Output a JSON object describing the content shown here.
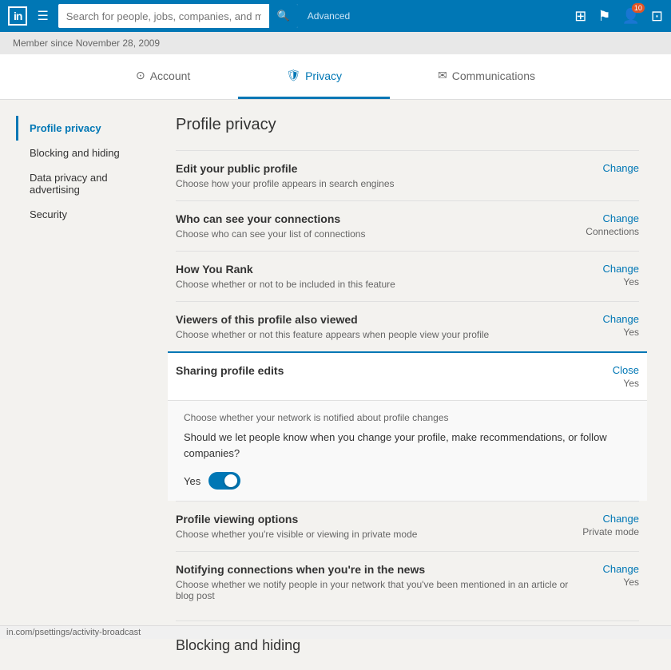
{
  "topnav": {
    "logo_text": "in",
    "search_placeholder": "Search for people, jobs, companies, and more...",
    "advanced_label": "Advanced",
    "notification_count": "10"
  },
  "subheader": {
    "member_since": "Member since November 28, 2009"
  },
  "tabs": [
    {
      "id": "account",
      "label": "Account",
      "icon": "⊙",
      "active": false
    },
    {
      "id": "privacy",
      "label": "Privacy",
      "icon": "🛡",
      "active": true
    },
    {
      "id": "communications",
      "label": "Communications",
      "icon": "✉",
      "active": false
    }
  ],
  "sidebar": {
    "items": [
      {
        "id": "profile-privacy",
        "label": "Profile privacy",
        "active": true
      },
      {
        "id": "blocking-hiding",
        "label": "Blocking and hiding",
        "active": false
      },
      {
        "id": "data-privacy",
        "label": "Data privacy and advertising",
        "active": false
      },
      {
        "id": "security",
        "label": "Security",
        "active": false
      }
    ]
  },
  "content": {
    "page_title": "Profile privacy",
    "settings": [
      {
        "id": "public-profile",
        "title": "Edit your public profile",
        "desc": "Choose how your profile appears in search engines",
        "action": "Change",
        "value": "",
        "expanded": false
      },
      {
        "id": "who-can-see",
        "title": "Who can see your connections",
        "desc": "Choose who can see your list of connections",
        "action": "Change",
        "value": "Connections",
        "expanded": false
      },
      {
        "id": "how-you-rank",
        "title": "How You Rank",
        "desc": "Choose whether or not to be included in this feature",
        "action": "Change",
        "value": "Yes",
        "expanded": false
      },
      {
        "id": "viewers-also-viewed",
        "title": "Viewers of this profile also viewed",
        "desc": "Choose whether or not this feature appears when people view your profile",
        "action": "Change",
        "value": "Yes",
        "expanded": false
      },
      {
        "id": "sharing-profile-edits",
        "title": "Sharing profile edits",
        "desc": "Choose whether your network is notified about profile changes",
        "action": "Close",
        "value": "Yes",
        "expanded": true,
        "expanded_question": "Should we let people know when you change your profile, make recommendations, or follow companies?",
        "toggle_label": "Yes",
        "toggle_on": true
      },
      {
        "id": "profile-viewing-options",
        "title": "Profile viewing options",
        "desc": "Choose whether you're visible or viewing in private mode",
        "action": "Change",
        "value": "Private mode",
        "expanded": false
      },
      {
        "id": "notifying-connections",
        "title": "Notifying connections when you're in the news",
        "desc": "Choose whether we notify people in your network that you've been mentioned in an article or blog post",
        "action": "Change",
        "value": "Yes",
        "expanded": false
      }
    ],
    "section_header": "Blocking and hiding"
  },
  "statusbar": {
    "url": "in.com/psettings/activity-broadcast"
  }
}
